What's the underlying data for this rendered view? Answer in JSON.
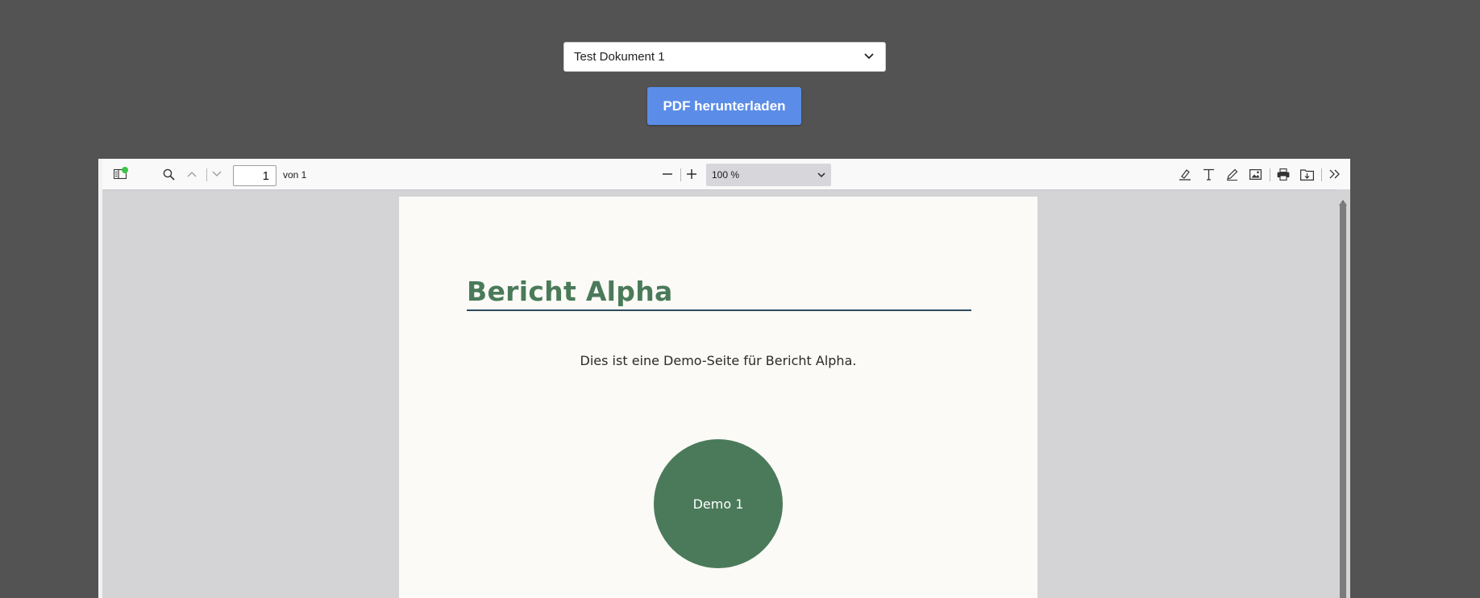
{
  "document_selector": {
    "selected": "Test Dokument 1",
    "icon": "chevron-down-icon"
  },
  "download_button": {
    "label": "PDF herunterladen"
  },
  "viewer": {
    "toolbar": {
      "sidebar_icon": "sidebar-toggle-icon",
      "notification_color": "#3ec447",
      "search_icon": "search-icon",
      "page_number": "1",
      "page_total": "von 1",
      "zoom_value": "100 %",
      "tools": [
        "highlight-icon",
        "text-icon",
        "draw-icon",
        "image-icon",
        "print-icon",
        "save-icon",
        "more-tools-icon"
      ]
    },
    "page": {
      "title": "Bericht Alpha",
      "body": "Dies ist eine Demo-Seite für Bericht Alpha.",
      "circle_label": "Demo 1",
      "accent_color": "#4a7a5a"
    }
  },
  "colors": {
    "background": "#535353",
    "button": "#5b8de8",
    "viewer_bg": "#d4d4d7"
  }
}
